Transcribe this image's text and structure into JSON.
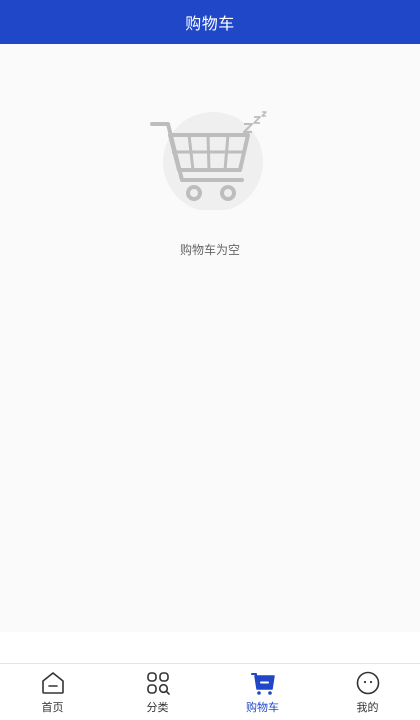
{
  "header": {
    "title": "购物车"
  },
  "cart": {
    "empty_text": "购物车为空",
    "illustration_icon": "sleeping-cart-icon"
  },
  "tabbar": {
    "active_index": 2,
    "items": [
      {
        "label": "首页",
        "icon": "home-icon"
      },
      {
        "label": "分类",
        "icon": "category-icon"
      },
      {
        "label": "购物车",
        "icon": "cart-icon"
      },
      {
        "label": "我的",
        "icon": "profile-icon"
      }
    ]
  },
  "colors": {
    "primary": "#1f47c8",
    "background": "#fafafa",
    "illustration_gray": "#bdbdbd",
    "tab_text": "#333333"
  }
}
